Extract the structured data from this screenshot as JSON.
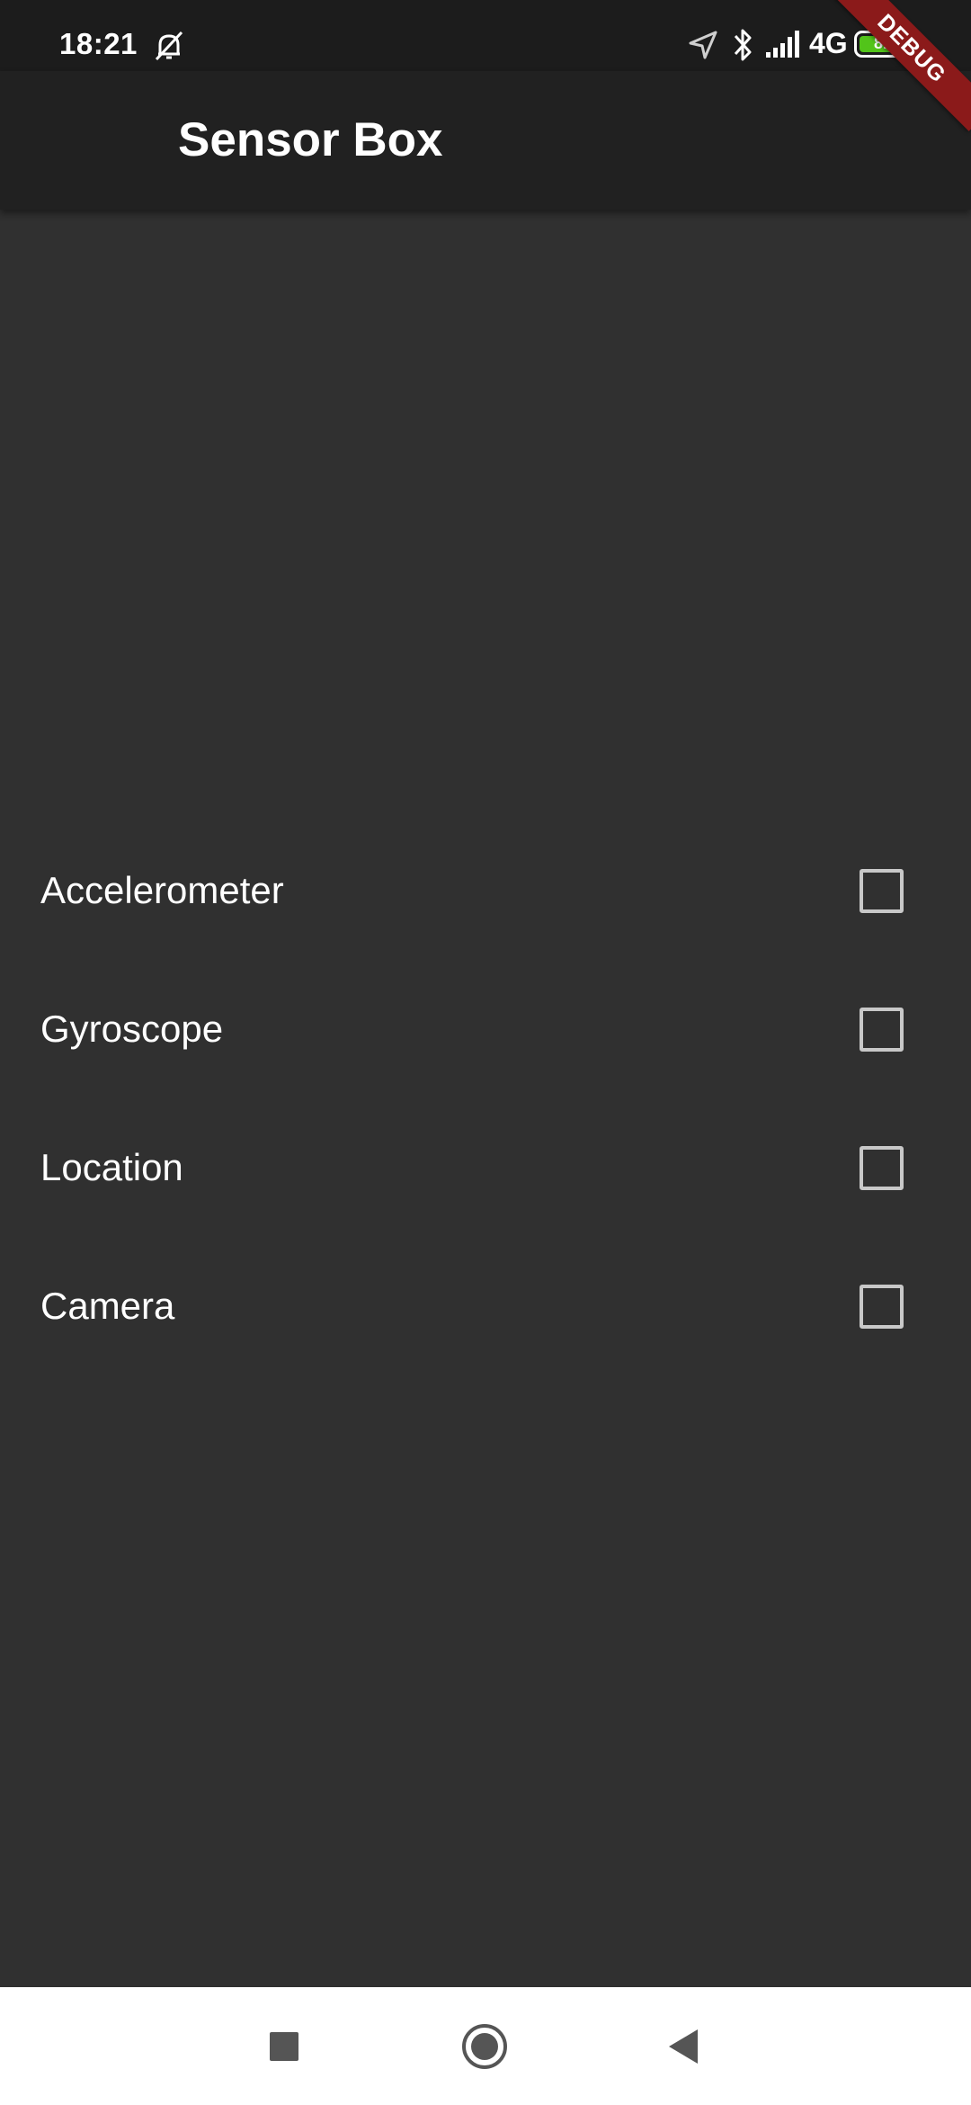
{
  "status_bar": {
    "time": "18:21",
    "network": "4G",
    "battery_level": "81",
    "battery_fraction": 0.81,
    "icons": [
      "do-not-disturb-icon",
      "location-icon",
      "bluetooth-icon",
      "signal-icon",
      "battery-icon"
    ]
  },
  "debug_banner": {
    "label": "DEBUG"
  },
  "app_bar": {
    "title": "Sensor Box"
  },
  "sensors": [
    {
      "label": "Accelerometer",
      "checked": false
    },
    {
      "label": "Gyroscope",
      "checked": false
    },
    {
      "label": "Location",
      "checked": false
    },
    {
      "label": "Camera",
      "checked": false
    }
  ],
  "nav_bar": {
    "icons": [
      "recents-icon",
      "home-icon",
      "back-icon"
    ]
  },
  "colors": {
    "status_bar": "#1c1c1c",
    "app_bar": "#212121",
    "background": "#303030",
    "checkbox_border": "#c8c8c8",
    "debug_banner": "#8b1a1a",
    "battery": "#52c41a"
  }
}
